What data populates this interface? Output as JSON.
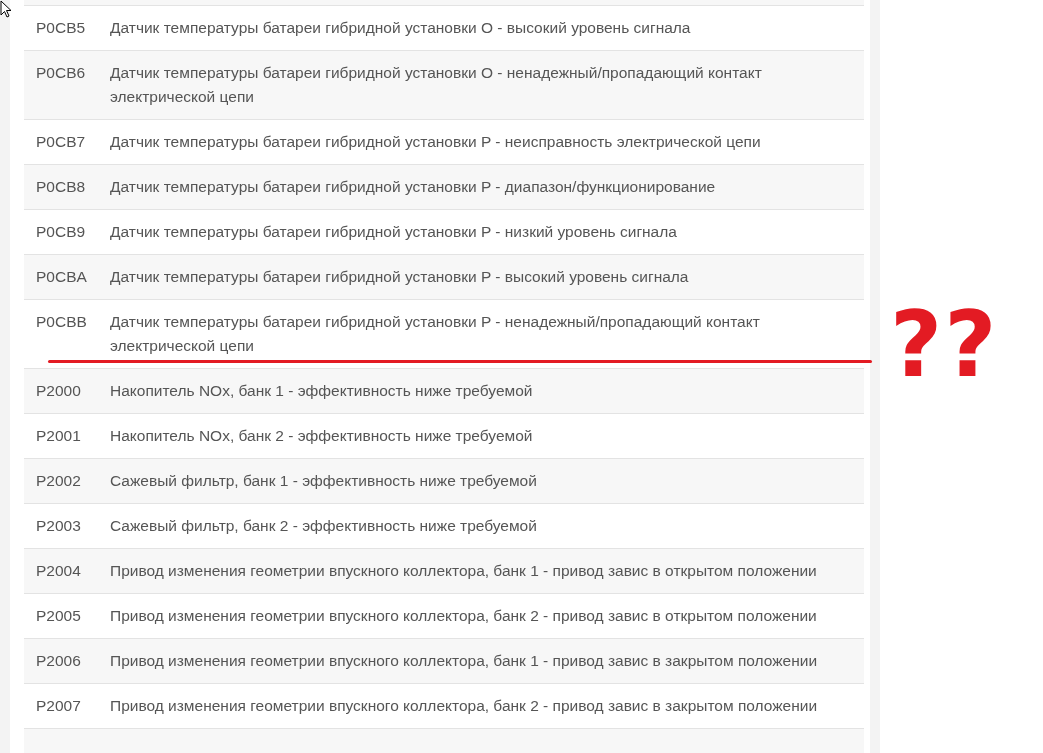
{
  "table": {
    "rows": [
      {
        "code": "P0CB5",
        "description": "Датчик температуры батареи гибридной установки O - высокий уровень сигнала"
      },
      {
        "code": "P0CB6",
        "description": "Датчик температуры батареи гибридной установки O - ненадежный/пропадающий контакт электрической цепи"
      },
      {
        "code": "P0CB7",
        "description": "Датчик температуры батареи гибридной установки P - неисправность электрической цепи"
      },
      {
        "code": "P0CB8",
        "description": "Датчик температуры батареи гибридной установки P - диапазон/функционирование"
      },
      {
        "code": "P0CB9",
        "description": "Датчик температуры батареи гибридной установки P - низкий уровень сигнала"
      },
      {
        "code": "P0CBA",
        "description": "Датчик температуры батареи гибридной установки P - высокий уровень сигнала"
      },
      {
        "code": "P0CBB",
        "description": "Датчик температуры батареи гибридной установки P - ненадежный/пропадающий контакт электрической цепи"
      },
      {
        "code": "P2000",
        "description": "Накопитель NOx, банк 1 - эффективность ниже требуемой"
      },
      {
        "code": "P2001",
        "description": "Накопитель NOx, банк 2 - эффективность ниже требуемой"
      },
      {
        "code": "P2002",
        "description": "Сажевый фильтр, банк 1 - эффективность ниже требуемой"
      },
      {
        "code": "P2003",
        "description": "Сажевый фильтр, банк 2 - эффективность ниже требуемой"
      },
      {
        "code": "P2004",
        "description": "Привод изменения геометрии впускного коллектора, банк 1 - привод завис в открытом положении"
      },
      {
        "code": "P2005",
        "description": "Привод изменения геометрии впускного коллектора, банк 2 - привод завис в открытом положении"
      },
      {
        "code": "P2006",
        "description": "Привод изменения геометрии впускного коллектора, банк 1 - привод завис в закрытом положении"
      },
      {
        "code": "P2007",
        "description": "Привод изменения геометрии впускного коллектора, банк 2 - привод завис в закрытом положении"
      }
    ]
  },
  "annotation": {
    "text": "??"
  }
}
